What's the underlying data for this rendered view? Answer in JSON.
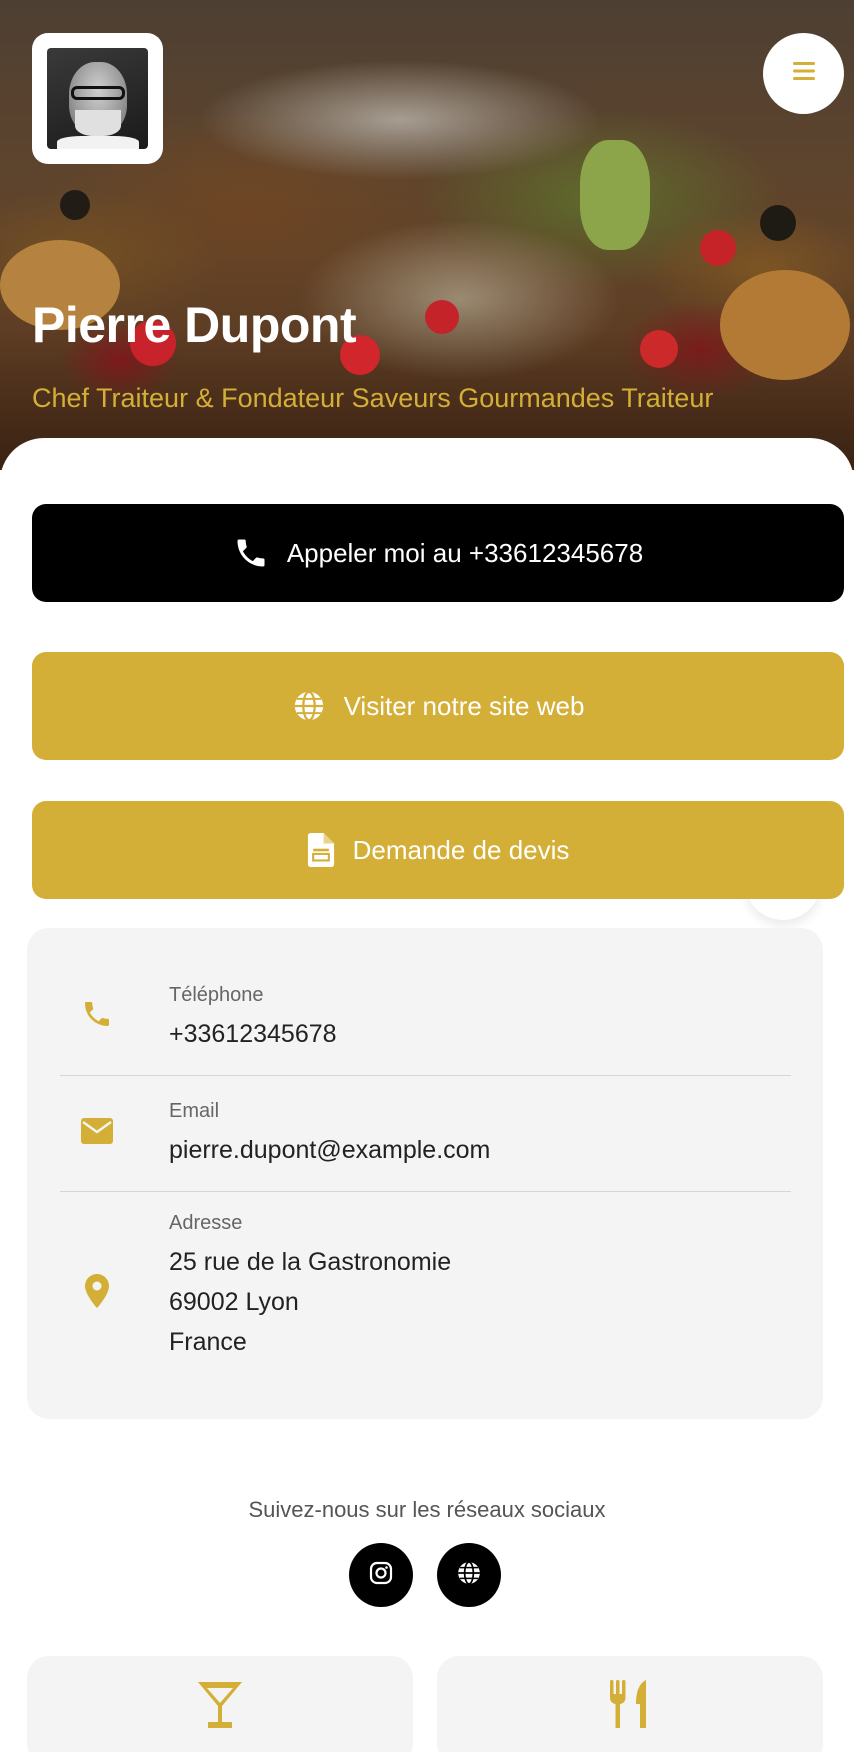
{
  "profile": {
    "name": "Pierre Dupont",
    "subtitle": "Chef Traiteur & Fondateur Saveurs Gourmandes Traiteur"
  },
  "header": {
    "menu_icon": "hamburger-icon"
  },
  "actions": {
    "call_label": "Appeler moi au +33612345678",
    "website_label": "Visiter notre site web",
    "quote_label": "Demande de devis"
  },
  "contact": {
    "phone_label": "Téléphone",
    "phone_value": "+33612345678",
    "email_label": "Email",
    "email_value": "pierre.dupont@example.com",
    "address_label": "Adresse",
    "address_line1": "25 rue de la Gastronomie",
    "address_line2": "69002 Lyon",
    "address_line3": "France"
  },
  "social": {
    "title": "Suivez-nous sur les réseaux sociaux",
    "items": [
      {
        "icon": "instagram-icon"
      },
      {
        "icon": "globe-icon"
      }
    ]
  },
  "services": [
    {
      "icon": "cocktail-icon"
    },
    {
      "icon": "utensils-icon"
    }
  ],
  "colors": {
    "accent": "#d4af37",
    "primary_button": "#000000",
    "card_background": "#f4f4f4"
  }
}
